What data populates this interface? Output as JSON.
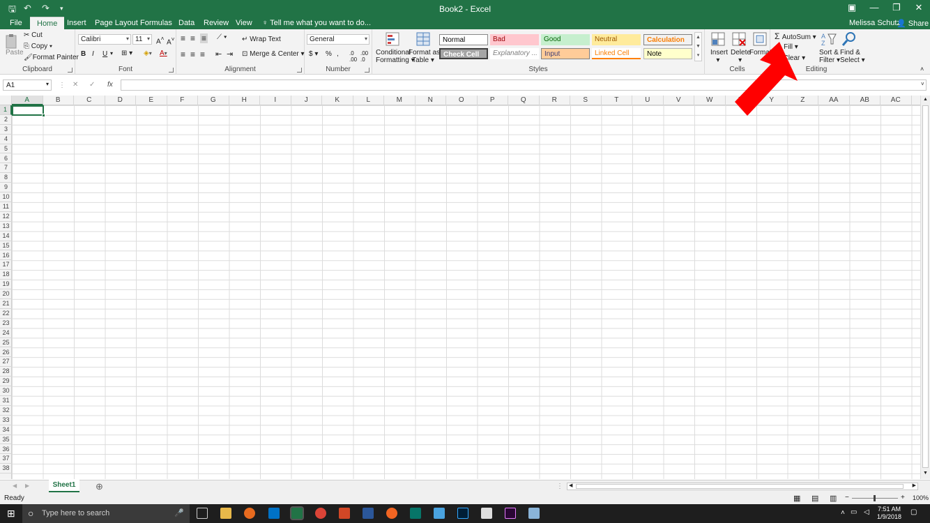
{
  "title_bar": {
    "title": "Book2 - Excel"
  },
  "tabs": [
    "File",
    "Home",
    "Insert",
    "Page Layout",
    "Formulas",
    "Data",
    "Review",
    "View"
  ],
  "tell_me": "Tell me what you want to do...",
  "user": "Melissa Schutz",
  "share": "Share",
  "clipboard": {
    "cut": "Cut",
    "copy": "Copy",
    "format_painter": "Format Painter",
    "paste": "Paste",
    "label": "Clipboard"
  },
  "font": {
    "name": "Calibri",
    "size": "11",
    "bold": "B",
    "italic": "I",
    "underline": "U",
    "label": "Font"
  },
  "alignment": {
    "wrap_text": "Wrap Text",
    "merge_center": "Merge & Center",
    "label": "Alignment"
  },
  "number": {
    "format": "General",
    "label": "Number"
  },
  "styles": {
    "conditional_formatting": [
      "Conditional",
      "Formatting"
    ],
    "format_as_table": [
      "Format as",
      "Table"
    ],
    "cells": [
      "Normal",
      "Bad",
      "Good",
      "Neutral",
      "Calculation",
      "Check Cell",
      "Explanatory ...",
      "Input",
      "Linked Cell",
      "Note"
    ],
    "label": "Styles"
  },
  "cells_group": {
    "insert": "Insert",
    "delete": "Delete",
    "format": "Format",
    "label": "Cells"
  },
  "editing": {
    "autosum": "AutoSum",
    "fill": "Fill",
    "clear": "Clear",
    "sort_filter": [
      "Sort &",
      "Filter"
    ],
    "find_select": [
      "Find &",
      "Select"
    ],
    "label": "Editing"
  },
  "formula_bar": {
    "name_box": "A1",
    "fx": "fx",
    "cancel": "✕",
    "enter": "✓"
  },
  "columns": [
    "A",
    "B",
    "C",
    "D",
    "E",
    "F",
    "G",
    "H",
    "I",
    "J",
    "K",
    "L",
    "M",
    "N",
    "O",
    "P",
    "Q",
    "R",
    "S",
    "T",
    "U",
    "V",
    "W",
    "X",
    "Y",
    "Z",
    "AA",
    "AB",
    "AC"
  ],
  "rows": [
    "1",
    "2",
    "3",
    "4",
    "5",
    "6",
    "7",
    "8",
    "9",
    "10",
    "11",
    "12",
    "13",
    "14",
    "15",
    "16",
    "17",
    "18",
    "19",
    "20",
    "21",
    "22",
    "23",
    "24",
    "25",
    "26",
    "27",
    "28",
    "29",
    "30",
    "31",
    "32",
    "33",
    "34",
    "35",
    "36",
    "37",
    "38"
  ],
  "sheet_tabs": [
    "Sheet1"
  ],
  "status": {
    "text": "Ready",
    "zoom": "100%"
  },
  "taskbar": {
    "search": "Type here to search",
    "time": "7:51 AM",
    "date": "1/9/2018"
  },
  "colors": {
    "excel_green": "#217346",
    "arrow_red": "#ff0000"
  }
}
